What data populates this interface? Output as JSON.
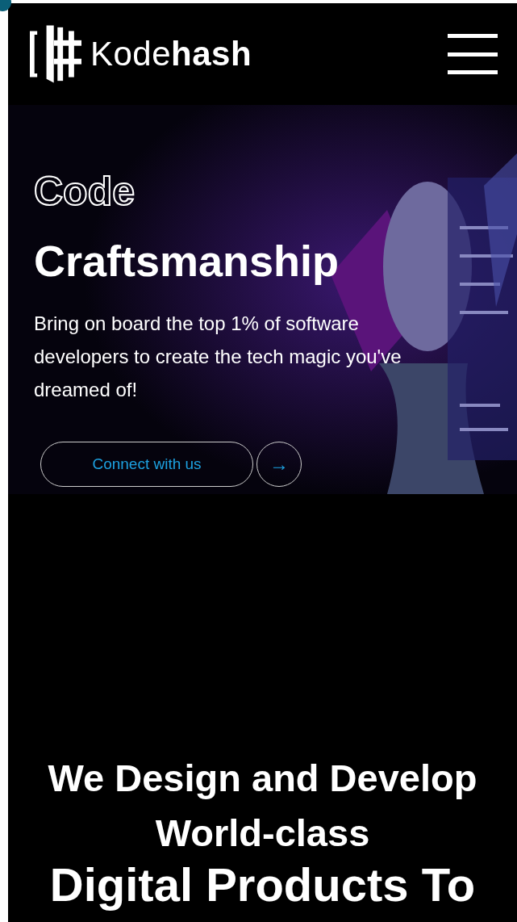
{
  "header": {
    "logo": "Kode**hash**"
  },
  "hero": {
    "eyebrow": "Code",
    "title": "Craftsmanship",
    "lead": "Bring on board the top 1% of software developers to create the tech magic you've dreamed of!",
    "cta": "Connect with us",
    "cta_icon": "→"
  },
  "headline": {
    "lines": [
      "We Design and Develop",
      "World-class"
    ],
    "big": "Digital Products To"
  }
}
